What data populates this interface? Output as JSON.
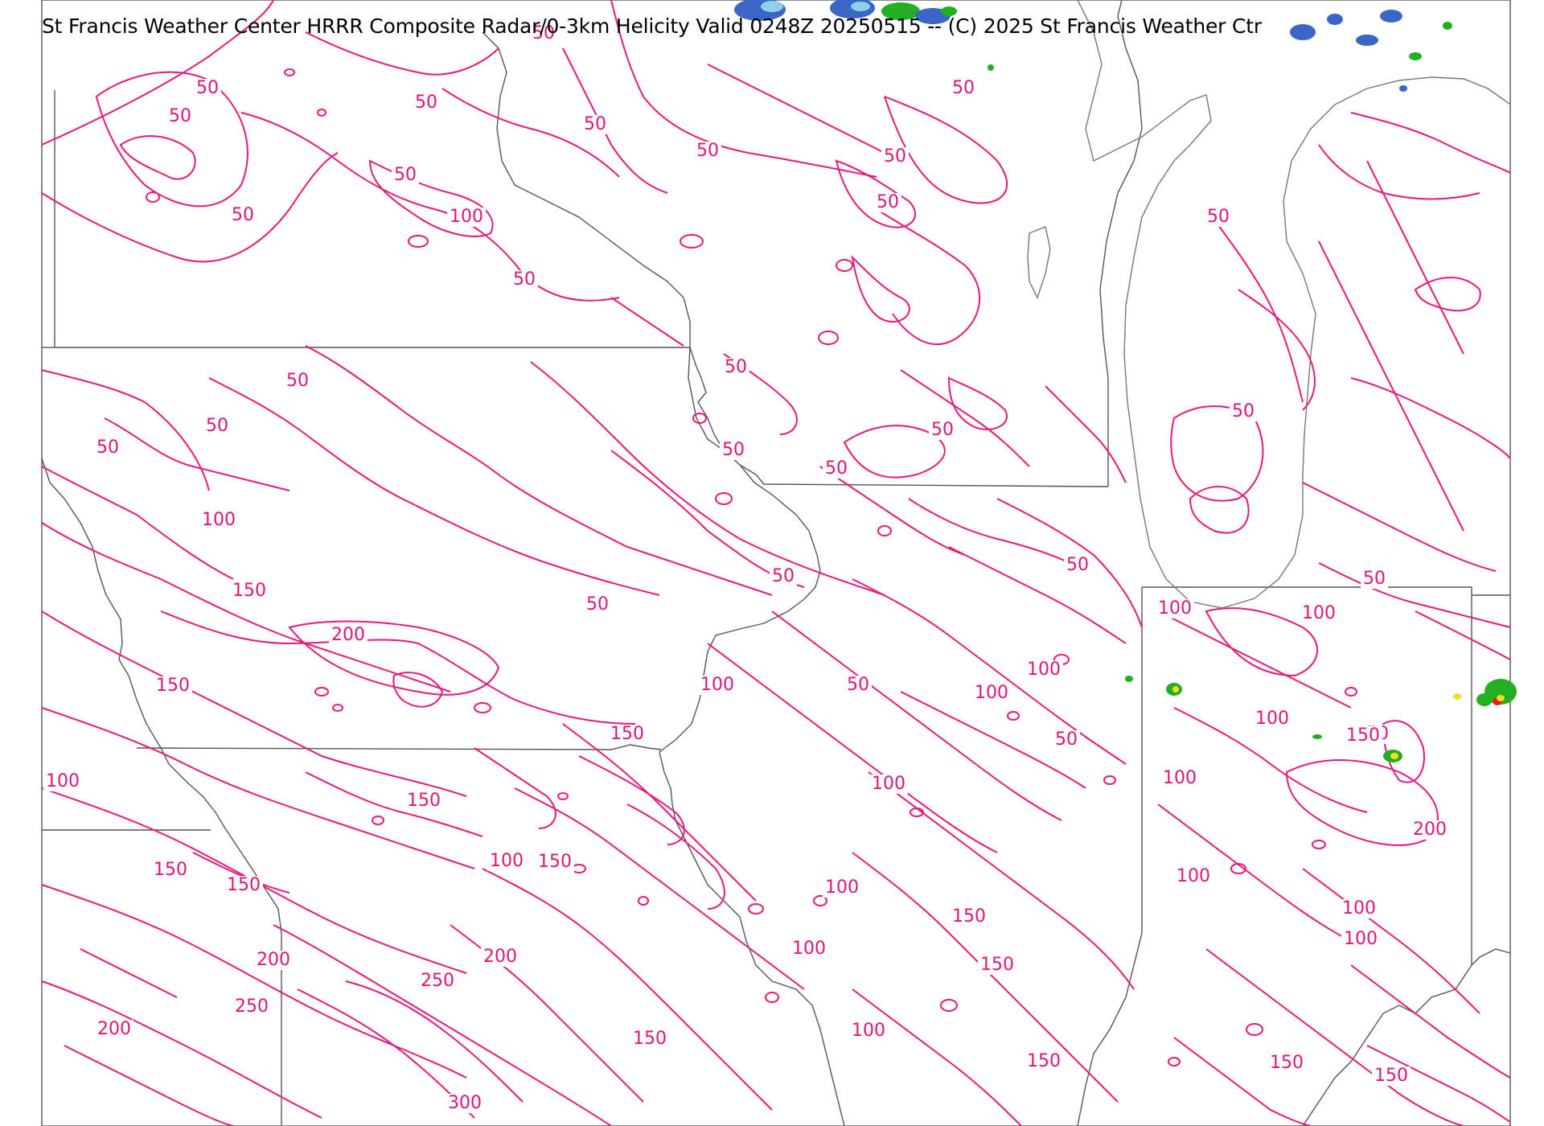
{
  "title": "St Francis Weather Center HRRR Composite Radar/0-3km Helicity  Valid  0248Z 20250515  -- (C) 2025 St Francis Weather Ctr",
  "colors": {
    "contour": "#e8187c",
    "label": "#e0157a",
    "state_lines": "#555555",
    "radar_green": "#22b022",
    "radar_yellow": "#f0e020",
    "radar_red": "#e02020",
    "radar_blue": "#3a66c8",
    "radar_lightblue": "#8fd0ea"
  },
  "contour_labels": [
    "50",
    "50",
    "50",
    "50",
    "50",
    "50",
    "50",
    "50",
    "50",
    "50",
    "50",
    "50",
    "50",
    "50",
    "50",
    "50",
    "50",
    "50",
    "50",
    "50",
    "50",
    "50",
    "50",
    "50",
    "50",
    "50",
    "50",
    "50",
    "100",
    "100",
    "100",
    "100",
    "100",
    "100",
    "100",
    "100",
    "100",
    "100",
    "100",
    "100",
    "100",
    "100",
    "100",
    "100",
    "100",
    "100",
    "150",
    "150",
    "150",
    "150",
    "150",
    "150",
    "150",
    "150",
    "150",
    "150",
    "150",
    "150",
    "150",
    "150",
    "200",
    "200",
    "200",
    "200",
    "200",
    "250",
    "250",
    "300"
  ]
}
